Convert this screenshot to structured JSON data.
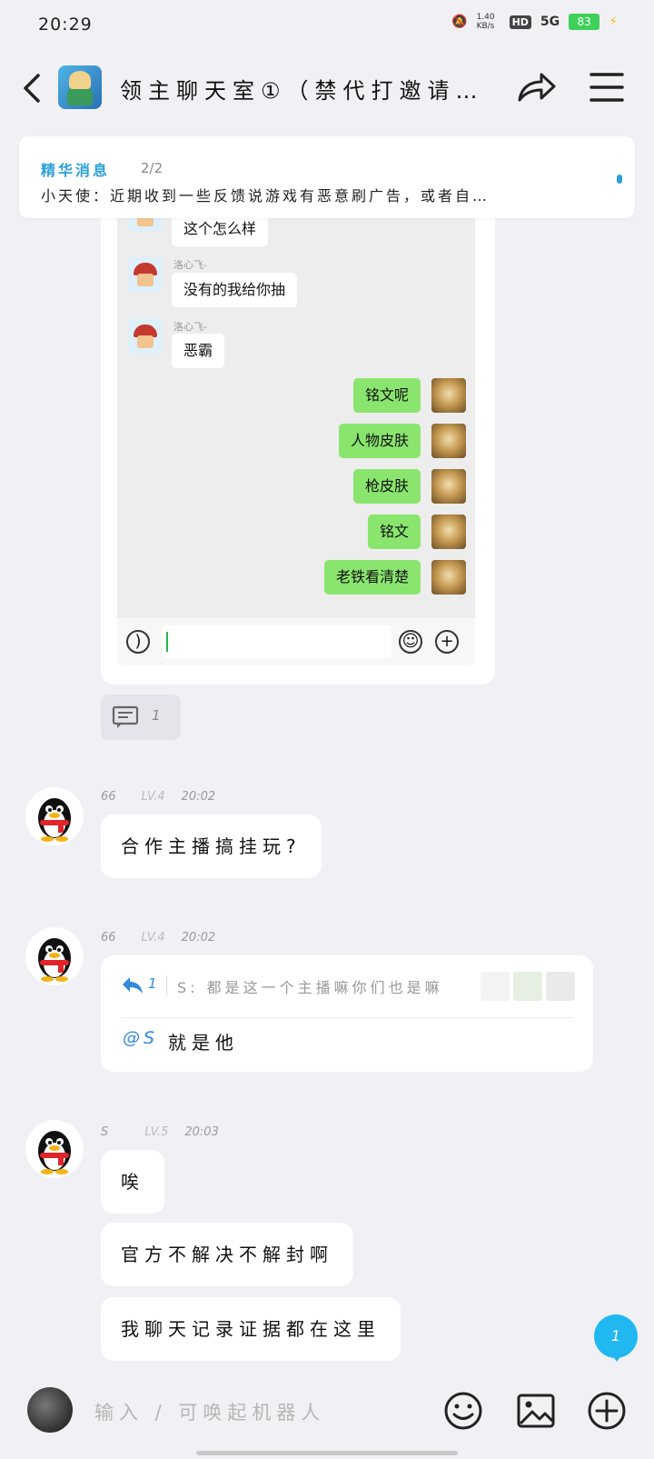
{
  "status_bar": {
    "time": "20:29",
    "net_speed": "1.40 KB/s",
    "hd_label": "HD",
    "signal_label": "5G",
    "battery": "83"
  },
  "header": {
    "title": "领主聊天室①（禁代打邀请…"
  },
  "pinned": {
    "label": "精华消息",
    "count": "2/2",
    "text": "小天使：近期收到一些反馈说游戏有恶意刷广告，或者自…"
  },
  "screenshot": {
    "left_messages": [
      {
        "nick": "",
        "text": "这个怎么样"
      },
      {
        "nick": "洛心飞-",
        "text": "没有的我给你抽"
      },
      {
        "nick": "洛心飞-",
        "text": "恶霸"
      }
    ],
    "right_messages": [
      "铭文呢",
      "人物皮肤",
      "枪皮肤",
      "铭文",
      "老铁看清楚"
    ]
  },
  "comment_count": "1",
  "messages": [
    {
      "name": "66",
      "level": "LV.4",
      "time": "20:02",
      "text": "合作主播搞挂玩?"
    },
    {
      "name": "66",
      "level": "LV.4",
      "time": "20:02",
      "reply_count": "1",
      "quote": "S: 都是这一个主播嘛你们也是嘛",
      "mention": "@S",
      "text": "就是他"
    },
    {
      "name": "S",
      "level": "LV.5",
      "time": "20:03",
      "texts": [
        "唉",
        "官方不解决不解封啊",
        "我聊天记录证据都在这里"
      ]
    }
  ],
  "fab_count": "1",
  "input": {
    "placeholder": "输入 / 可唤起机器人"
  },
  "colors": {
    "accent": "#21b8f2",
    "green_bubble": "#8ae56e",
    "battery": "#3fd05a"
  }
}
